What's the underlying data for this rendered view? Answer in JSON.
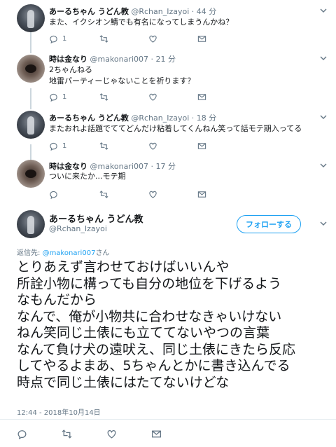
{
  "tweets": [
    {
      "name": "あーるちゃん うどん教",
      "handle": "@Rchan_Izayoi",
      "time": "44 分",
      "lines": [
        "また、イクシオン鯖でも有名になってしまうんかね？"
      ],
      "replies": "1",
      "retweets": "",
      "likes": ""
    },
    {
      "name": "時は金なり",
      "handle": "@makonari007",
      "time": "21 分",
      "lines": [
        "2ちゃんねる",
        "地雷パーティーじゃないことを祈ります？"
      ],
      "replies": "1",
      "retweets": "",
      "likes": ""
    },
    {
      "name": "あーるちゃん うどん教",
      "handle": "@Rchan_Izayoi",
      "time": "18 分",
      "lines": [
        "またおれよ話題でててどんだけ粘着してくんねん笑って話モテ期入ってる"
      ],
      "replies": "1",
      "retweets": "",
      "likes": ""
    },
    {
      "name": "時は金なり",
      "handle": "@makonari007",
      "time": "17 分",
      "lines": [
        "ついに来たか...モテ期"
      ],
      "replies": "",
      "retweets": "",
      "likes": ""
    }
  ],
  "main": {
    "name": "あーるちゃん うどん教",
    "handle": "@Rchan_Izayoi",
    "follow_label": "フォローする",
    "reply_prefix": "返信先: ",
    "reply_handle": "@makonari007",
    "reply_suffix": "さん",
    "text": "とりあえず言わせておけばいいんや\n所詮小物に構っても自分の地位を下げるよう\nなもんだから\nなんで、俺が小物共に合わせなきゃいけない\nねん笑同じ土俵にも立ててないやつの言葉\nなんて負け犬の遠吠え、同じ土俵にきたら反応\nしてやるよまあ、5ちゃんとかに書き込んでる\n時点で同じ土俵にはたてないけどな",
    "timestamp": "12:44 - 2018年10月14日"
  }
}
